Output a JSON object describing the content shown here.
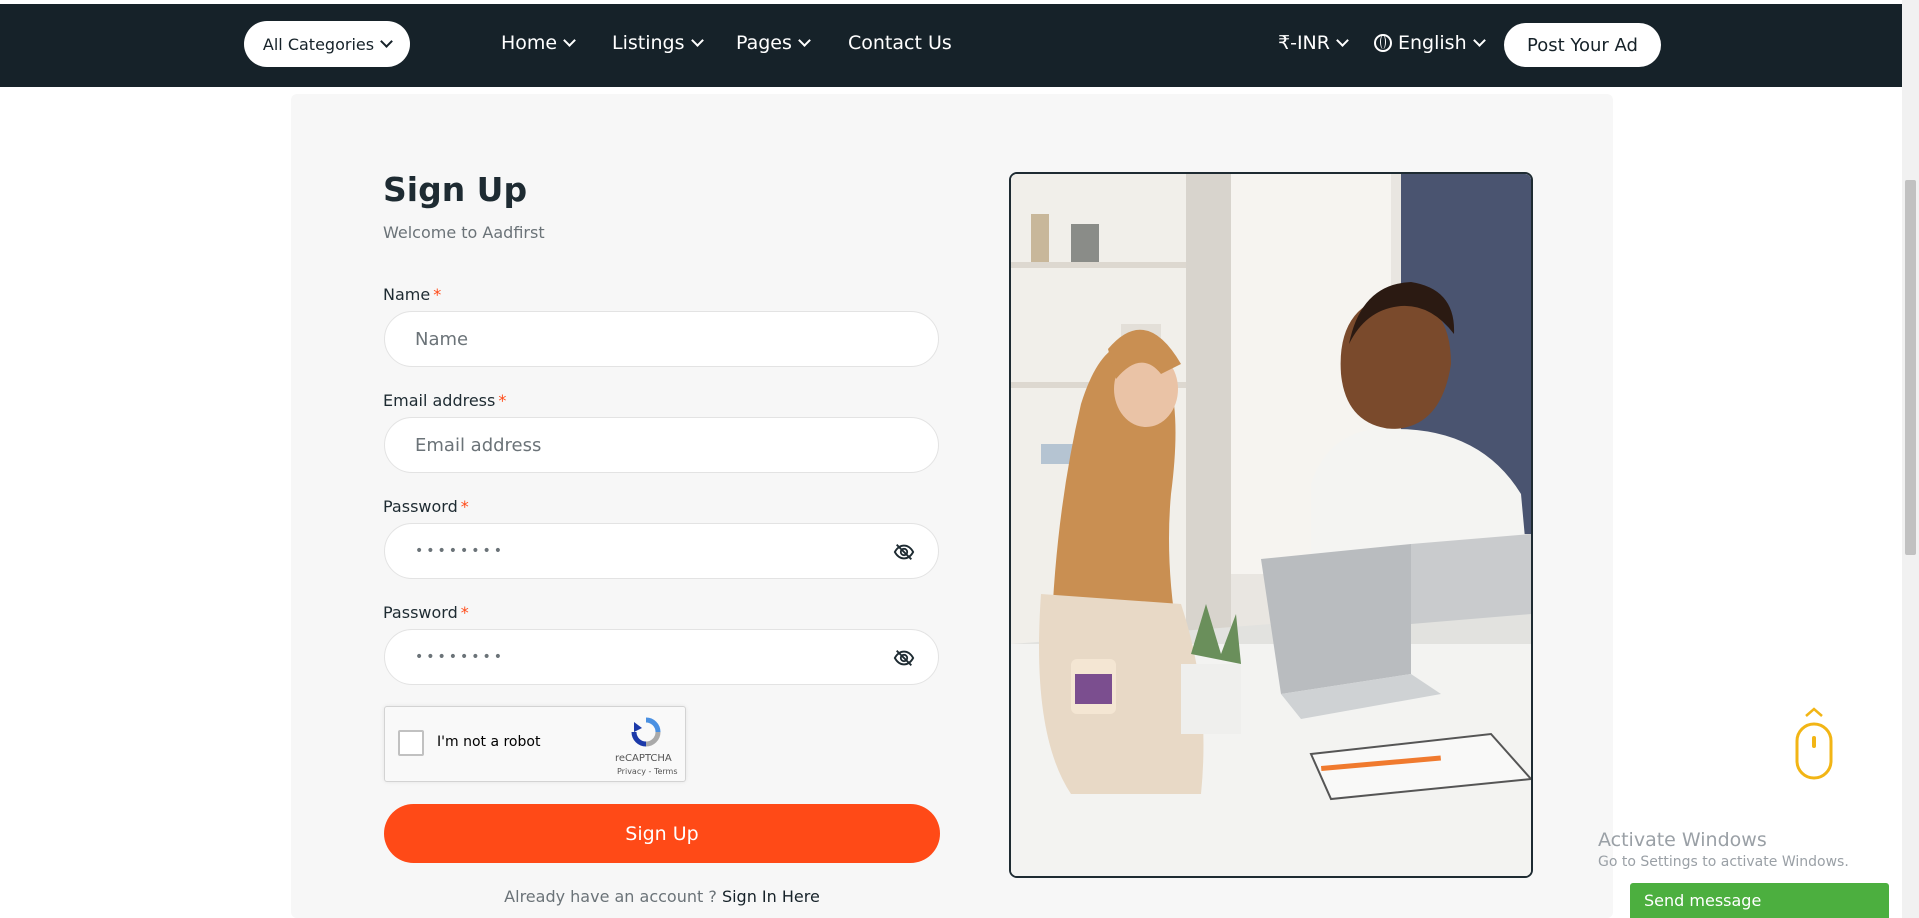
{
  "header": {
    "category_select": "All Categories",
    "nav": [
      {
        "label": "Home"
      },
      {
        "label": "Listings"
      },
      {
        "label": "Pages"
      },
      {
        "label": "Contact Us"
      }
    ],
    "currency": "₹-INR",
    "language": "English",
    "post_ad": "Post Your Ad"
  },
  "form": {
    "title": "Sign Up",
    "subtitle": "Welcome to Aadfirst",
    "name_label": "Name",
    "name_placeholder": "Name",
    "email_label": "Email address",
    "email_placeholder": "Email address",
    "password_label": "Password",
    "password_mask": "••••••••",
    "confirm_label": "Password",
    "confirm_mask": "••••••••",
    "required_mark": "*",
    "submit": "Sign Up",
    "have_account": "Already have an account ?",
    "signin_link": "Sign In Here"
  },
  "captcha": {
    "label": "I'm not a robot",
    "brand": "reCAPTCHA",
    "links": "Privacy - Terms"
  },
  "os": {
    "activate_title": "Activate Windows",
    "activate_sub": "Go to Settings to activate Windows."
  },
  "chat": {
    "label": "Send message"
  },
  "colors": {
    "nav_bg": "#162229",
    "accent": "#ff4a17",
    "chat_green": "#4caf3f"
  }
}
